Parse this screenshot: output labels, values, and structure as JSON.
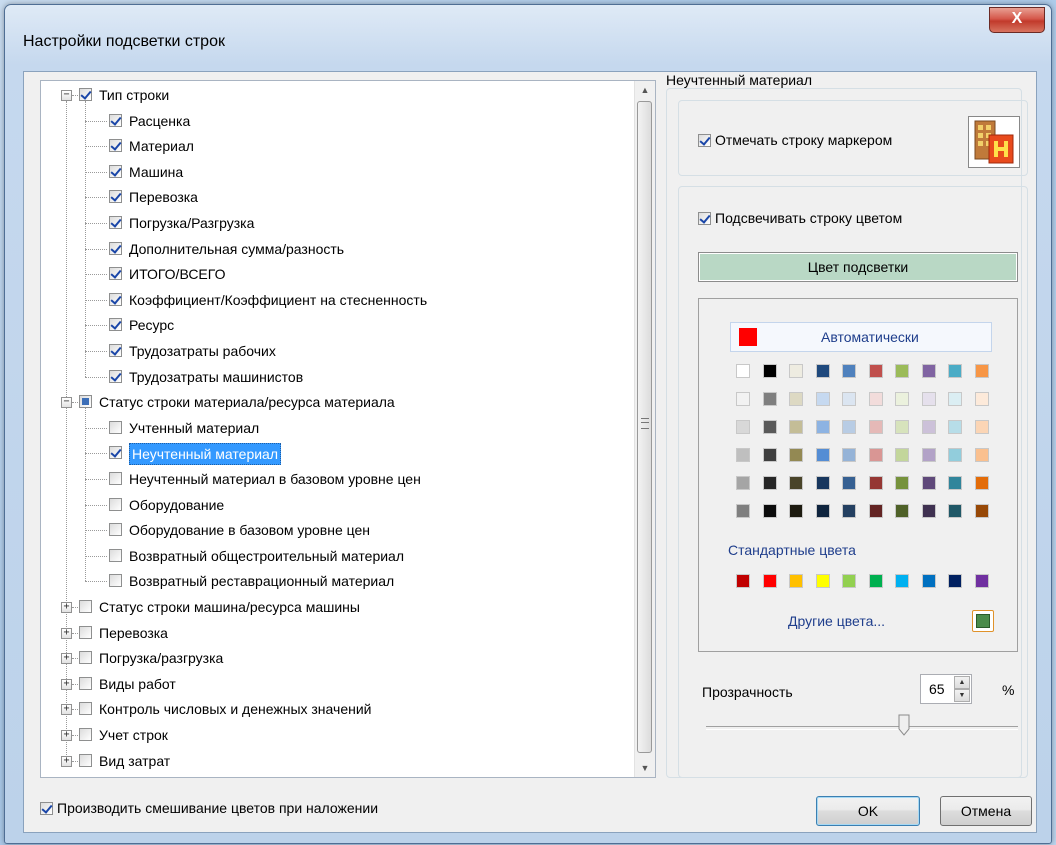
{
  "window": {
    "title": "Настройки подсветки строк",
    "close_glyph": "X"
  },
  "tree": {
    "items": [
      {
        "label": "Тип строки",
        "level": 0,
        "expander": "−",
        "check": "on"
      },
      {
        "label": "Расценка",
        "level": 1,
        "check": "on"
      },
      {
        "label": "Материал",
        "level": 1,
        "check": "on"
      },
      {
        "label": "Машина",
        "level": 1,
        "check": "on"
      },
      {
        "label": "Перевозка",
        "level": 1,
        "check": "on"
      },
      {
        "label": "Погрузка/Разгрузка",
        "level": 1,
        "check": "on"
      },
      {
        "label": "Дополнительная сумма/разность",
        "level": 1,
        "check": "on"
      },
      {
        "label": "ИТОГО/ВСЕГО",
        "level": 1,
        "check": "on"
      },
      {
        "label": "Коэффициент/Коэффициент на стесненность",
        "level": 1,
        "check": "on"
      },
      {
        "label": "Ресурс",
        "level": 1,
        "check": "on"
      },
      {
        "label": "Трудозатраты рабочих",
        "level": 1,
        "check": "on"
      },
      {
        "label": "Трудозатраты машинистов",
        "level": 1,
        "check": "on"
      },
      {
        "label": "Статус строки материала/ресурса материала",
        "level": 0,
        "expander": "−",
        "check": "tri"
      },
      {
        "label": "Учтенный материал",
        "level": 1,
        "check": "off"
      },
      {
        "label": "Неучтенный материал",
        "level": 1,
        "check": "on",
        "selected": true
      },
      {
        "label": "Неучтенный материал в базовом уровне цен",
        "level": 1,
        "check": "off"
      },
      {
        "label": "Оборудование",
        "level": 1,
        "check": "off"
      },
      {
        "label": "Оборудование в базовом уровне цен",
        "level": 1,
        "check": "off"
      },
      {
        "label": "Возвратный общестроительный материал",
        "level": 1,
        "check": "off"
      },
      {
        "label": "Возвратный реставрационный материал",
        "level": 1,
        "check": "off"
      },
      {
        "label": "Статус строки машина/ресурса машины",
        "level": 0,
        "expander": "+",
        "check": "off"
      },
      {
        "label": "Перевозка",
        "level": 0,
        "expander": "+",
        "check": "off"
      },
      {
        "label": "Погрузка/разгрузка",
        "level": 0,
        "expander": "+",
        "check": "off"
      },
      {
        "label": "Виды работ",
        "level": 0,
        "expander": "+",
        "check": "off"
      },
      {
        "label": "Контроль числовых и денежных значений",
        "level": 0,
        "expander": "+",
        "check": "off"
      },
      {
        "label": "Учет строк",
        "level": 0,
        "expander": "+",
        "check": "off"
      },
      {
        "label": "Вид затрат",
        "level": 0,
        "expander": "+",
        "check": "off"
      }
    ]
  },
  "settings": {
    "group_title": "Неучтенный материал",
    "mark_with_marker": {
      "label": "Отмечать строку маркером",
      "checked": true
    },
    "highlight_with_color": {
      "label": "Подсвечивать строку цветом",
      "checked": true
    },
    "highlight_color_button": "Цвет подсветки",
    "highlight_color": "#b9d8c5",
    "palette": {
      "auto_label": "Автоматически",
      "auto_color": "#ff0000",
      "theme_colors": [
        [
          "#ffffff",
          "#000000",
          "#eeece1",
          "#1f497d",
          "#4f81bd",
          "#c0504d",
          "#9bbb59",
          "#8064a2",
          "#4bacc6",
          "#f79646"
        ],
        [
          "#f2f2f2",
          "#7f7f7f",
          "#ddd9c3",
          "#c6d9f0",
          "#dbe5f1",
          "#f2dcdb",
          "#ebf1dd",
          "#e5e0ec",
          "#dbeef3",
          "#fdeada"
        ],
        [
          "#d8d8d8",
          "#595959",
          "#c4bd97",
          "#8db3e2",
          "#b8cce4",
          "#e5b9b7",
          "#d7e3bc",
          "#ccc1d9",
          "#b7dde8",
          "#fbd5b5"
        ],
        [
          "#bfbfbf",
          "#3f3f3f",
          "#938953",
          "#548dd4",
          "#95b3d7",
          "#d99694",
          "#c3d69b",
          "#b2a2c7",
          "#92cddc",
          "#fac08f"
        ],
        [
          "#a5a5a5",
          "#262626",
          "#494429",
          "#17365d",
          "#366092",
          "#953734",
          "#76923c",
          "#5f497a",
          "#31859b",
          "#e36c09"
        ],
        [
          "#7f7f7f",
          "#0c0c0c",
          "#1d1b10",
          "#0f243e",
          "#244061",
          "#632423",
          "#4f6128",
          "#3f3151",
          "#205867",
          "#974806"
        ]
      ],
      "standard_label": "Стандартные цвета",
      "standard_colors": [
        "#c00000",
        "#ff0000",
        "#ffc000",
        "#ffff00",
        "#92d050",
        "#00b050",
        "#00b0f0",
        "#0070c0",
        "#002060",
        "#7030a0"
      ],
      "other_label": "Другие цвета...",
      "other_color": "#4a8b4a"
    },
    "transparency": {
      "label": "Прозрачность",
      "value": "65",
      "unit": "%",
      "level_fraction": 0.65
    }
  },
  "footer": {
    "blend_checkbox": {
      "label": "Производить смешивание цветов при наложении",
      "checked": true
    },
    "ok_label": "OK",
    "cancel_label": "Отмена"
  }
}
